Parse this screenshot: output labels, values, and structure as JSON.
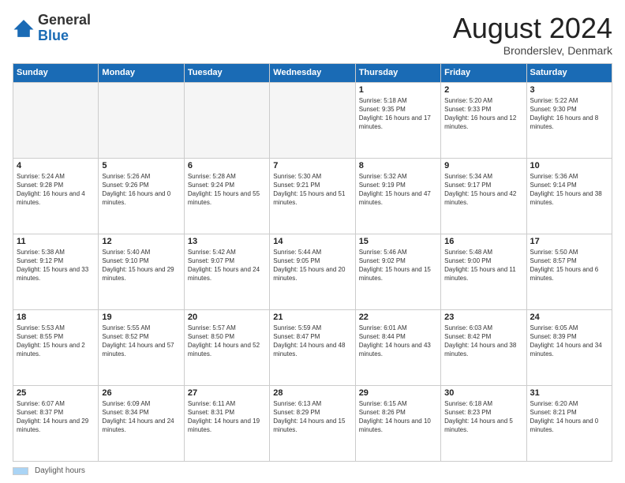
{
  "header": {
    "logo_general": "General",
    "logo_blue": "Blue",
    "title": "August 2024",
    "location": "Bronderslev, Denmark"
  },
  "days_of_week": [
    "Sunday",
    "Monday",
    "Tuesday",
    "Wednesday",
    "Thursday",
    "Friday",
    "Saturday"
  ],
  "weeks": [
    [
      {
        "day": "",
        "empty": true
      },
      {
        "day": "",
        "empty": true
      },
      {
        "day": "",
        "empty": true
      },
      {
        "day": "",
        "empty": true
      },
      {
        "day": "1",
        "sunrise": "5:18 AM",
        "sunset": "9:35 PM",
        "daylight": "16 hours and 17 minutes."
      },
      {
        "day": "2",
        "sunrise": "5:20 AM",
        "sunset": "9:33 PM",
        "daylight": "16 hours and 12 minutes."
      },
      {
        "day": "3",
        "sunrise": "5:22 AM",
        "sunset": "9:30 PM",
        "daylight": "16 hours and 8 minutes."
      }
    ],
    [
      {
        "day": "4",
        "sunrise": "5:24 AM",
        "sunset": "9:28 PM",
        "daylight": "16 hours and 4 minutes."
      },
      {
        "day": "5",
        "sunrise": "5:26 AM",
        "sunset": "9:26 PM",
        "daylight": "16 hours and 0 minutes."
      },
      {
        "day": "6",
        "sunrise": "5:28 AM",
        "sunset": "9:24 PM",
        "daylight": "15 hours and 55 minutes."
      },
      {
        "day": "7",
        "sunrise": "5:30 AM",
        "sunset": "9:21 PM",
        "daylight": "15 hours and 51 minutes."
      },
      {
        "day": "8",
        "sunrise": "5:32 AM",
        "sunset": "9:19 PM",
        "daylight": "15 hours and 47 minutes."
      },
      {
        "day": "9",
        "sunrise": "5:34 AM",
        "sunset": "9:17 PM",
        "daylight": "15 hours and 42 minutes."
      },
      {
        "day": "10",
        "sunrise": "5:36 AM",
        "sunset": "9:14 PM",
        "daylight": "15 hours and 38 minutes."
      }
    ],
    [
      {
        "day": "11",
        "sunrise": "5:38 AM",
        "sunset": "9:12 PM",
        "daylight": "15 hours and 33 minutes."
      },
      {
        "day": "12",
        "sunrise": "5:40 AM",
        "sunset": "9:10 PM",
        "daylight": "15 hours and 29 minutes."
      },
      {
        "day": "13",
        "sunrise": "5:42 AM",
        "sunset": "9:07 PM",
        "daylight": "15 hours and 24 minutes."
      },
      {
        "day": "14",
        "sunrise": "5:44 AM",
        "sunset": "9:05 PM",
        "daylight": "15 hours and 20 minutes."
      },
      {
        "day": "15",
        "sunrise": "5:46 AM",
        "sunset": "9:02 PM",
        "daylight": "15 hours and 15 minutes."
      },
      {
        "day": "16",
        "sunrise": "5:48 AM",
        "sunset": "9:00 PM",
        "daylight": "15 hours and 11 minutes."
      },
      {
        "day": "17",
        "sunrise": "5:50 AM",
        "sunset": "8:57 PM",
        "daylight": "15 hours and 6 minutes."
      }
    ],
    [
      {
        "day": "18",
        "sunrise": "5:53 AM",
        "sunset": "8:55 PM",
        "daylight": "15 hours and 2 minutes."
      },
      {
        "day": "19",
        "sunrise": "5:55 AM",
        "sunset": "8:52 PM",
        "daylight": "14 hours and 57 minutes."
      },
      {
        "day": "20",
        "sunrise": "5:57 AM",
        "sunset": "8:50 PM",
        "daylight": "14 hours and 52 minutes."
      },
      {
        "day": "21",
        "sunrise": "5:59 AM",
        "sunset": "8:47 PM",
        "daylight": "14 hours and 48 minutes."
      },
      {
        "day": "22",
        "sunrise": "6:01 AM",
        "sunset": "8:44 PM",
        "daylight": "14 hours and 43 minutes."
      },
      {
        "day": "23",
        "sunrise": "6:03 AM",
        "sunset": "8:42 PM",
        "daylight": "14 hours and 38 minutes."
      },
      {
        "day": "24",
        "sunrise": "6:05 AM",
        "sunset": "8:39 PM",
        "daylight": "14 hours and 34 minutes."
      }
    ],
    [
      {
        "day": "25",
        "sunrise": "6:07 AM",
        "sunset": "8:37 PM",
        "daylight": "14 hours and 29 minutes."
      },
      {
        "day": "26",
        "sunrise": "6:09 AM",
        "sunset": "8:34 PM",
        "daylight": "14 hours and 24 minutes."
      },
      {
        "day": "27",
        "sunrise": "6:11 AM",
        "sunset": "8:31 PM",
        "daylight": "14 hours and 19 minutes."
      },
      {
        "day": "28",
        "sunrise": "6:13 AM",
        "sunset": "8:29 PM",
        "daylight": "14 hours and 15 minutes."
      },
      {
        "day": "29",
        "sunrise": "6:15 AM",
        "sunset": "8:26 PM",
        "daylight": "14 hours and 10 minutes."
      },
      {
        "day": "30",
        "sunrise": "6:18 AM",
        "sunset": "8:23 PM",
        "daylight": "14 hours and 5 minutes."
      },
      {
        "day": "31",
        "sunrise": "6:20 AM",
        "sunset": "8:21 PM",
        "daylight": "14 hours and 0 minutes."
      }
    ]
  ],
  "footer": {
    "swatch_label": "Daylight hours"
  }
}
